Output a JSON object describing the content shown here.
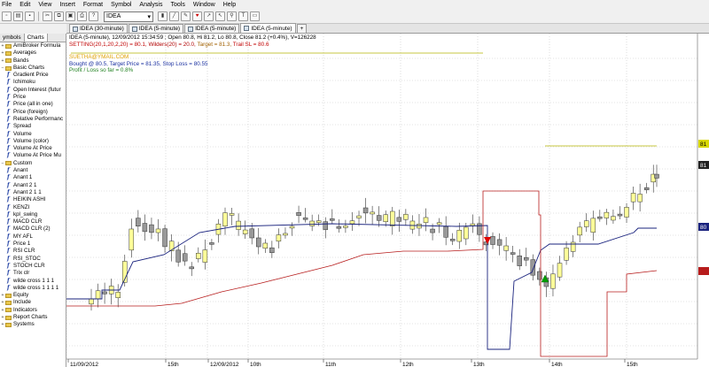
{
  "menu": [
    "File",
    "Edit",
    "View",
    "Insert",
    "Format",
    "Symbol",
    "Analysis",
    "Tools",
    "Window",
    "Help"
  ],
  "toolbar": {
    "symbol": "IDEA"
  },
  "sidebar": {
    "tabs": [
      "ymbols",
      "Charts"
    ],
    "items": [
      {
        "type": "folder",
        "label": "AmiBroker Formula",
        "level": 0
      },
      {
        "type": "folder",
        "label": "Averages",
        "level": 0
      },
      {
        "type": "folder",
        "label": "Bands",
        "level": 0
      },
      {
        "type": "folder",
        "label": "Basic Charts",
        "level": 0,
        "expanded": true
      },
      {
        "type": "formula",
        "label": "Gradient Price"
      },
      {
        "type": "formula",
        "label": "Ichimoku"
      },
      {
        "type": "formula",
        "label": "Open Interest (futur"
      },
      {
        "type": "formula",
        "label": "Price"
      },
      {
        "type": "formula",
        "label": "Price (all in one)"
      },
      {
        "type": "formula",
        "label": "Price (foreign)"
      },
      {
        "type": "formula",
        "label": "Relative Performanc"
      },
      {
        "type": "formula",
        "label": "Spread"
      },
      {
        "type": "formula",
        "label": "Volume"
      },
      {
        "type": "formula",
        "label": "Volume (color)"
      },
      {
        "type": "formula",
        "label": "Volume At Price"
      },
      {
        "type": "formula",
        "label": "Volume At Price Mu"
      },
      {
        "type": "folder",
        "label": "Custom",
        "level": 0,
        "expanded": true
      },
      {
        "type": "formula",
        "label": "Anant"
      },
      {
        "type": "formula",
        "label": "Anant 1"
      },
      {
        "type": "formula",
        "label": "Anant 2 1"
      },
      {
        "type": "formula",
        "label": "Anant 2 1 1"
      },
      {
        "type": "formula",
        "label": "HEIKIN ASHI"
      },
      {
        "type": "formula",
        "label": "KENZI"
      },
      {
        "type": "formula",
        "label": "kpl_swing"
      },
      {
        "type": "formula",
        "label": "MACD CLR"
      },
      {
        "type": "formula",
        "label": "MACD CLR (2)"
      },
      {
        "type": "formula",
        "label": "MY AFL"
      },
      {
        "type": "formula",
        "label": "Price 1"
      },
      {
        "type": "formula",
        "label": "RSI CLR"
      },
      {
        "type": "formula",
        "label": "RSI_STOC"
      },
      {
        "type": "formula",
        "label": "STOCH CLR"
      },
      {
        "type": "formula",
        "label": "Trix clr"
      },
      {
        "type": "formula",
        "label": "wilde cross 1 1 1"
      },
      {
        "type": "formula",
        "label": "wilde cross 1 1 1 1"
      },
      {
        "type": "folder",
        "label": "Equity",
        "level": 0
      },
      {
        "type": "folder",
        "label": "Include",
        "level": 0
      },
      {
        "type": "folder",
        "label": "Indicators",
        "level": 0
      },
      {
        "type": "folder",
        "label": "Report Charts",
        "level": 0
      },
      {
        "type": "folder",
        "label": "Systems",
        "level": 0
      }
    ]
  },
  "tabs": [
    {
      "label": "IDEA (30-minute)"
    },
    {
      "label": "IDEA (5-minute)"
    },
    {
      "label": "IDEA (5-minute)"
    },
    {
      "label": "IDEA (5-minute)",
      "active": true
    },
    {
      "label": "+"
    }
  ],
  "chart_info": {
    "line1": "IDEA (5-minute), 12/09/2012 15:34:59 ; Open 80.8, Hi 81.2, Lo 80.8, Close 81.2 (+0.4%), V=126228",
    "line2_a": "SETTING(20,1,20,2,20) = 80.1,",
    "line2_b": "Wilders(20) = 20.0,",
    "line2_c": "Target = 81.3,",
    "line2_d": "Trail SL = 80.6",
    "line3": "SUETHA@YMAIL.COM",
    "line4": "Bought @ 80.5, Target Price = 81.35, Stop Loss = 80.55",
    "line5": "Profit / Loss so far = 0.8%"
  },
  "chart_data": {
    "type": "candlestick",
    "x_labels": [
      "11/09/2012",
      "15th",
      "12/09/2012",
      "10th",
      "11th",
      "12th",
      "13th",
      "14th",
      "15th"
    ],
    "price_labels": [
      "81",
      "81",
      "80"
    ],
    "colors": {
      "up": "#ffff99",
      "down": "#999999",
      "trail": "#1a237e",
      "stop": "#b71c1c",
      "target": "#b5b500",
      "buy": "#00a000",
      "sell": "#e00000"
    }
  }
}
